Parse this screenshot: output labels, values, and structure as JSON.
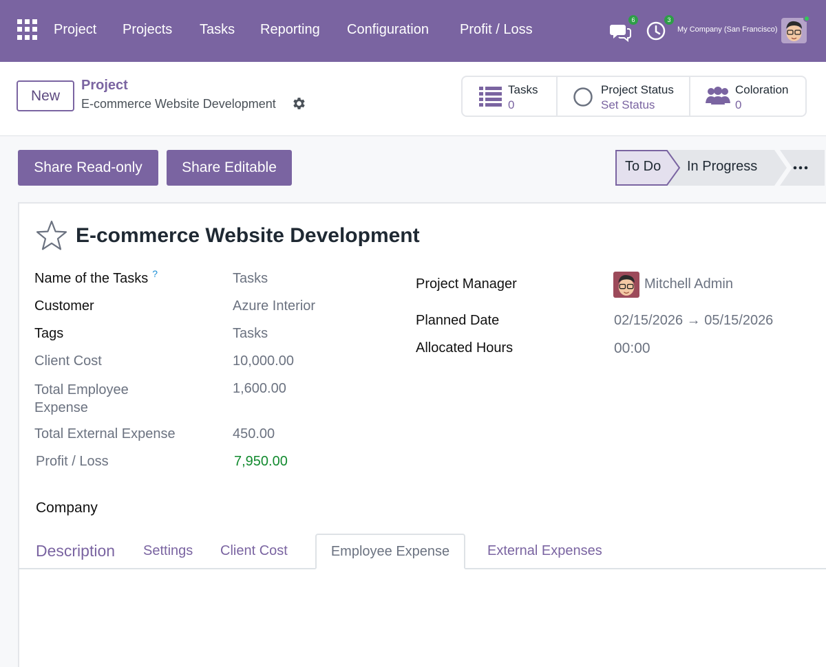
{
  "nav": {
    "items": [
      "Project",
      "Projects",
      "Tasks",
      "Reporting",
      "Configuration",
      "Profit / Loss"
    ],
    "chat_badge": "6",
    "activity_badge": "3",
    "company": "My Company (San Francisco)"
  },
  "breadcrumb": {
    "new_label": "New",
    "parent": "Project",
    "current": "E-commerce Website Development"
  },
  "stats": [
    {
      "label": "Tasks",
      "value": "0",
      "icon": "list-icon"
    },
    {
      "label": "Project Status",
      "value": "Set Status",
      "icon": "circle-status-icon"
    },
    {
      "label": "Coloration",
      "value": "0",
      "icon": "users-icon"
    }
  ],
  "actions": {
    "share_readonly": "Share Read-only",
    "share_editable": "Share Editable"
  },
  "stages": {
    "current": "To Do",
    "next": "In Progress",
    "more": "..."
  },
  "form": {
    "title": "E-commerce Website Development",
    "left": [
      {
        "label": "Name of the Tasks",
        "value": "Tasks",
        "help": "?"
      },
      {
        "label": "Customer",
        "value": "Azure Interior"
      },
      {
        "label": "Tags",
        "value": "Tasks"
      },
      {
        "label": "Client Cost",
        "value": "10,000.00"
      },
      {
        "label": "Total Employee Expense",
        "value": "1,600.00"
      },
      {
        "label": "Total External Expense",
        "value": "450.00"
      },
      {
        "label": "Profit / Loss",
        "value": "7,950.00"
      }
    ],
    "right": [
      {
        "label": "Project Manager",
        "value": "Mitchell Admin"
      },
      {
        "label": "Planned Date",
        "value": "02/15/2026 → 05/15/2026"
      },
      {
        "label": "Allocated Hours",
        "value": "00:00"
      }
    ],
    "company_label": "Company"
  },
  "tabs": [
    "Description",
    "Settings",
    "Client Cost",
    "Employee Expense",
    "External Expenses"
  ],
  "colors": {
    "brand": "#7a64a1",
    "profit": "#118a2e"
  }
}
